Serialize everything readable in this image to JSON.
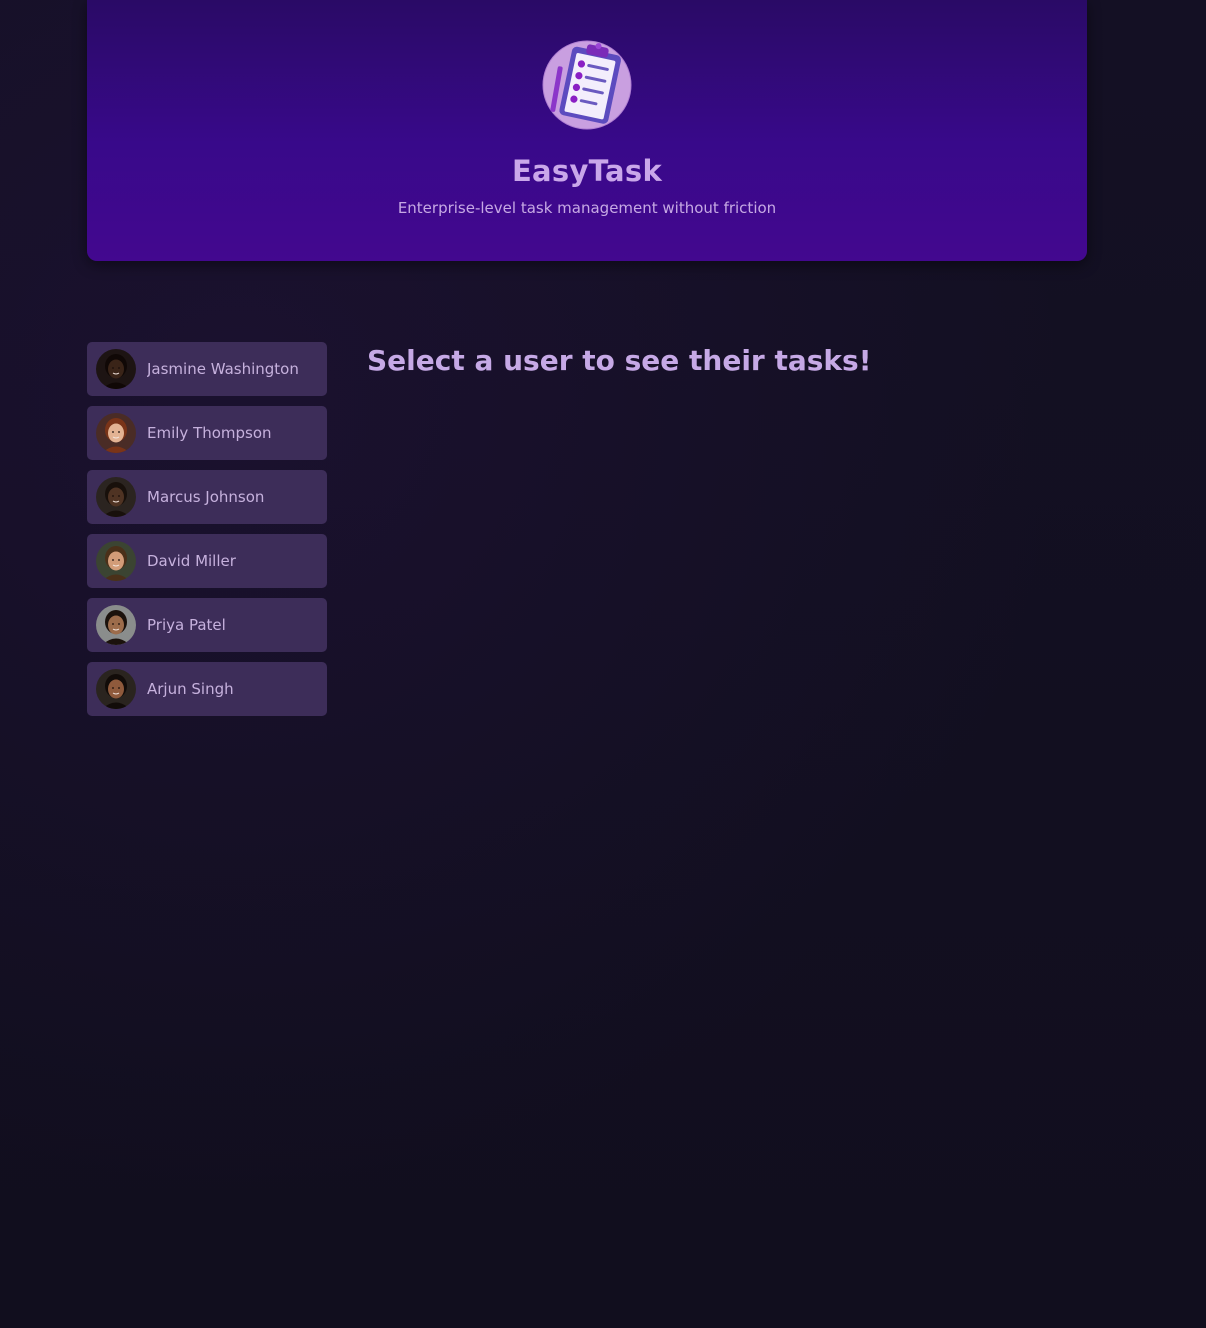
{
  "header": {
    "title": "EasyTask",
    "subtitle": "Enterprise-level task management without friction",
    "logo_icon": "clipboard-tasks-icon"
  },
  "users": [
    {
      "name": "Jasmine Washington",
      "skin": "#3a2418",
      "hair": "#100806",
      "bg": "#1d1413"
    },
    {
      "name": "Emily Thompson",
      "skin": "#e3b393",
      "hair": "#7a3418",
      "bg": "#4a2c26"
    },
    {
      "name": "Marcus Johnson",
      "skin": "#4f3323",
      "hair": "#18100b",
      "bg": "#2b2420"
    },
    {
      "name": "David Miller",
      "skin": "#d29c78",
      "hair": "#4a3019",
      "bg": "#3b4432"
    },
    {
      "name": "Priya Patel",
      "skin": "#9c6c4b",
      "hair": "#1b120c",
      "bg": "#8a8d8c"
    },
    {
      "name": "Arjun Singh",
      "skin": "#8f5a3c",
      "hair": "#120c09",
      "bg": "#2a241f"
    }
  ],
  "fallback": {
    "text": "Select a user to see their tasks!"
  },
  "colors": {
    "header_top": "#2a0a66",
    "header_bottom": "#43088f",
    "page_bg": "#12101f",
    "user_button_bg": "#3d2d59",
    "text_accent": "#c9a7ea"
  }
}
